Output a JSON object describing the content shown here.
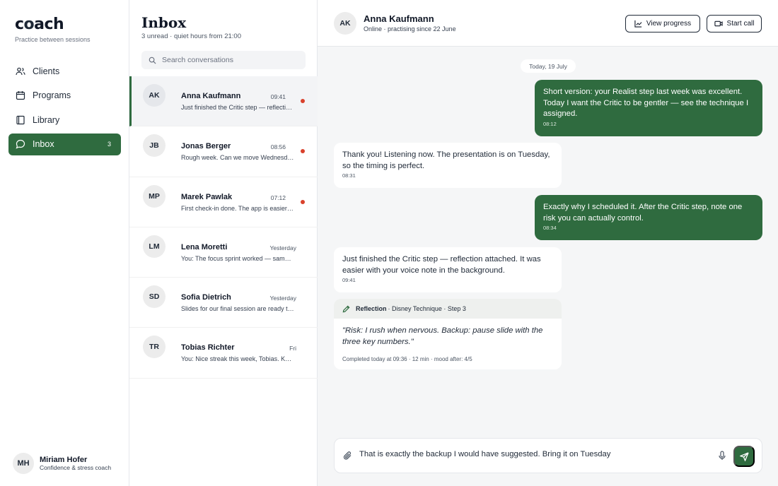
{
  "brand": {
    "name_pre": "c",
    "name_o": "o",
    "name_post": "ach",
    "tagline": "Practice between sessions"
  },
  "nav": {
    "items": [
      {
        "label": "Clients",
        "icon": "users-icon"
      },
      {
        "label": "Programs",
        "icon": "calendar-icon"
      },
      {
        "label": "Library",
        "icon": "book-icon"
      },
      {
        "label": "Inbox",
        "icon": "chat-icon",
        "count": "3",
        "active": true
      }
    ]
  },
  "user": {
    "initials": "MH",
    "name": "Miriam Hofer",
    "role": "Confidence & stress coach"
  },
  "inbox": {
    "title": "Inbox",
    "subtitle": "3 unread · quiet hours from 21:00",
    "search_placeholder": "Search conversations",
    "conversations": [
      {
        "initials": "AK",
        "name": "Anna Kaufmann",
        "time": "09:41",
        "preview": "Just finished the Critic step — reflection attached.",
        "unread": true,
        "active": true
      },
      {
        "initials": "JB",
        "name": "Jonas Berger",
        "time": "08:56",
        "preview": "Rough week. Can we move Wednesday's session?",
        "unread": true
      },
      {
        "initials": "MP",
        "name": "Marek Pawlak",
        "time": "07:12",
        "preview": "First check-in done. The app is easier than I thought.",
        "unread": true
      },
      {
        "initials": "LM",
        "name": "Lena Moretti",
        "time": "Yesterday",
        "preview": "You: The focus sprint worked — same again this week?",
        "unread": false
      },
      {
        "initials": "SD",
        "name": "Sofia Dietrich",
        "time": "Yesterday",
        "preview": "Slides for our final session are ready to review.",
        "unread": false
      },
      {
        "initials": "TR",
        "name": "Tobias Richter",
        "time": "Fri",
        "preview": "You: Nice streak this week, Tobias. Keep it going.",
        "unread": false
      }
    ]
  },
  "chat": {
    "initials": "AK",
    "name": "Anna Kaufmann",
    "status": "Online · practising since 22 June",
    "view_progress": "View progress",
    "start_call": "Start call",
    "date_label": "Today, 19 July",
    "messages": [
      {
        "dir": "out",
        "text": "Short version: your Realist step last week was excellent. Today I want the Critic to be gentler — see the technique I assigned.",
        "time": "08:12"
      },
      {
        "dir": "in",
        "text": "Thank you! Listening now. The presentation is on Tuesday, so the timing is perfect.",
        "time": "08:31"
      },
      {
        "dir": "out",
        "text": "Exactly why I scheduled it. After the Critic step, note one risk you can actually control.",
        "time": "08:34"
      },
      {
        "dir": "in",
        "text": "Just finished the Critic step — reflection attached. It was easier with your voice note in the background.",
        "time": "09:41"
      }
    ],
    "reflection": {
      "label": "Reflection",
      "technique": "· Disney Technique · Step 3",
      "quote": "\"Risk: I rush when nervous. Backup: pause slide with the three key numbers.\"",
      "footer": "Completed today at 09:36 · 12 min · mood after: 4/5"
    },
    "composer_value": "That is exactly the backup I would have suggested. Bring it on Tuesday"
  },
  "colors": {
    "accent": "#2f6b3f",
    "unread_dot": "#d9412b",
    "chat_bg": "#f5f6f7"
  }
}
